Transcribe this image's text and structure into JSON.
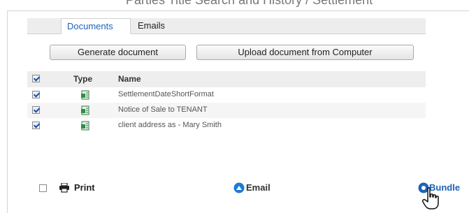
{
  "header_fragment": "Parties     Title Search and History / Settlement",
  "tabs": [
    {
      "label": "Documents",
      "active": true
    },
    {
      "label": "Emails",
      "active": false
    }
  ],
  "buttons": {
    "generate": "Generate document",
    "upload": "Upload document from Computer"
  },
  "table": {
    "columns": [
      "Type",
      "Name"
    ],
    "rows": [
      {
        "name": "SettlementDateShortFormat",
        "checked": true,
        "icon": "document-icon"
      },
      {
        "name": "Notice of Sale to TENANT",
        "checked": true,
        "icon": "document-icon"
      },
      {
        "name": "client address as  - Mary  Smith",
        "checked": true,
        "icon": "document-icon"
      }
    ]
  },
  "footer": {
    "print": "Print",
    "email": "Email",
    "bundle": "Bundle"
  },
  "colors": {
    "accent": "#1d63b8",
    "tab_bar": "#ededed",
    "row_alt": "#f5f5f5"
  }
}
